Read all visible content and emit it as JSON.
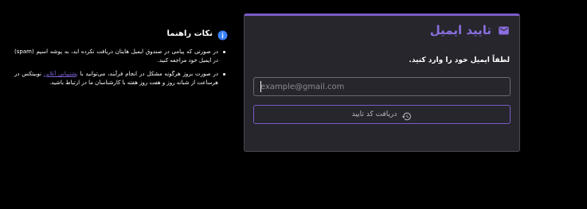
{
  "verify_card": {
    "title": "تایید ایمیل",
    "prompt": "لطفاً ایمیل خود را وارد کنید.",
    "email_placeholder": "example@gmail.com",
    "email_value": "",
    "get_code_label": "دریافت کد تایید",
    "accent_color": "#7b5cc6",
    "icons": {
      "header": "mail-icon",
      "button": "history-icon"
    }
  },
  "tips": {
    "title": "نکات راهنما",
    "icon": "info-icon",
    "items": [
      {
        "text": "در صورتی که پیامی در صندوق ایمیل هایتان دریافت نکرده اید، به پوشه اسپم (spam) در ایمیل خود مراجعه کنید."
      },
      {
        "text_before": "در صورت بروز هرگونه مشکل در انجام فرآیند، می‌توانید با ",
        "link": "پشتیبانی آنلاین",
        "text_after": " نوبیتکس در هرساعت از شبانه روز و هفت روز هفته با کارشناسان ما در ارتباط باشید."
      }
    ],
    "link_color": "#7e62d6"
  }
}
